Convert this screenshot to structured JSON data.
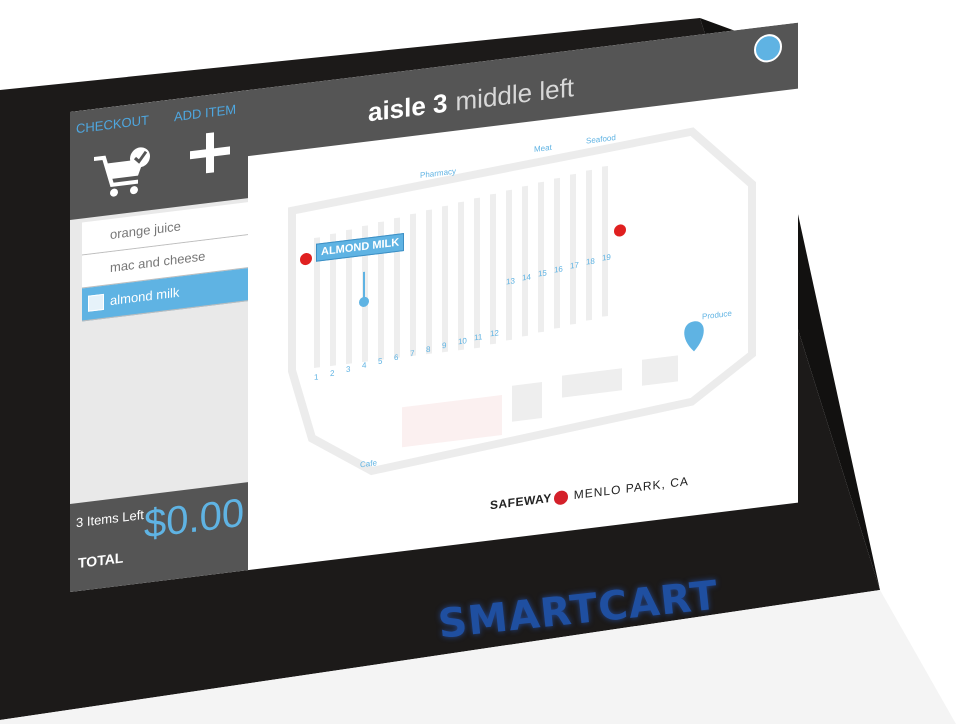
{
  "device": {
    "brand_label": "SMARTCART"
  },
  "sidebar": {
    "checkout_label": "CHECKOUT",
    "add_item_label": "ADD ITEM",
    "icons": [
      "cart-check-icon",
      "plus-icon"
    ],
    "items": [
      {
        "label": "orange juice",
        "active": false
      },
      {
        "label": "mac and cheese",
        "active": false
      },
      {
        "label": "almond milk",
        "active": true
      }
    ],
    "items_left": "3 Items Left",
    "total_label": "TOTAL",
    "total_value": "$0.00"
  },
  "header": {
    "aisle_label": "aisle 3",
    "position_label": "middle  left",
    "help_icon": "cart-help-icon"
  },
  "map": {
    "sections": [
      "Pharmacy",
      "Meat",
      "Seafood",
      "Produce",
      "Cafe"
    ],
    "aisles": [
      "1",
      "2",
      "3",
      "4",
      "5",
      "6",
      "7",
      "8",
      "9",
      "10",
      "11",
      "12",
      "13",
      "14",
      "15",
      "16",
      "17",
      "18",
      "19"
    ],
    "callout": "ALMOND MILK",
    "store_brand": "SAFEWAY",
    "store_location": "MENLO PARK, CA"
  },
  "colors": {
    "accent": "#5fb3e3",
    "panel": "#555555",
    "marker": "#e02020",
    "device": "#1a1a1a"
  }
}
